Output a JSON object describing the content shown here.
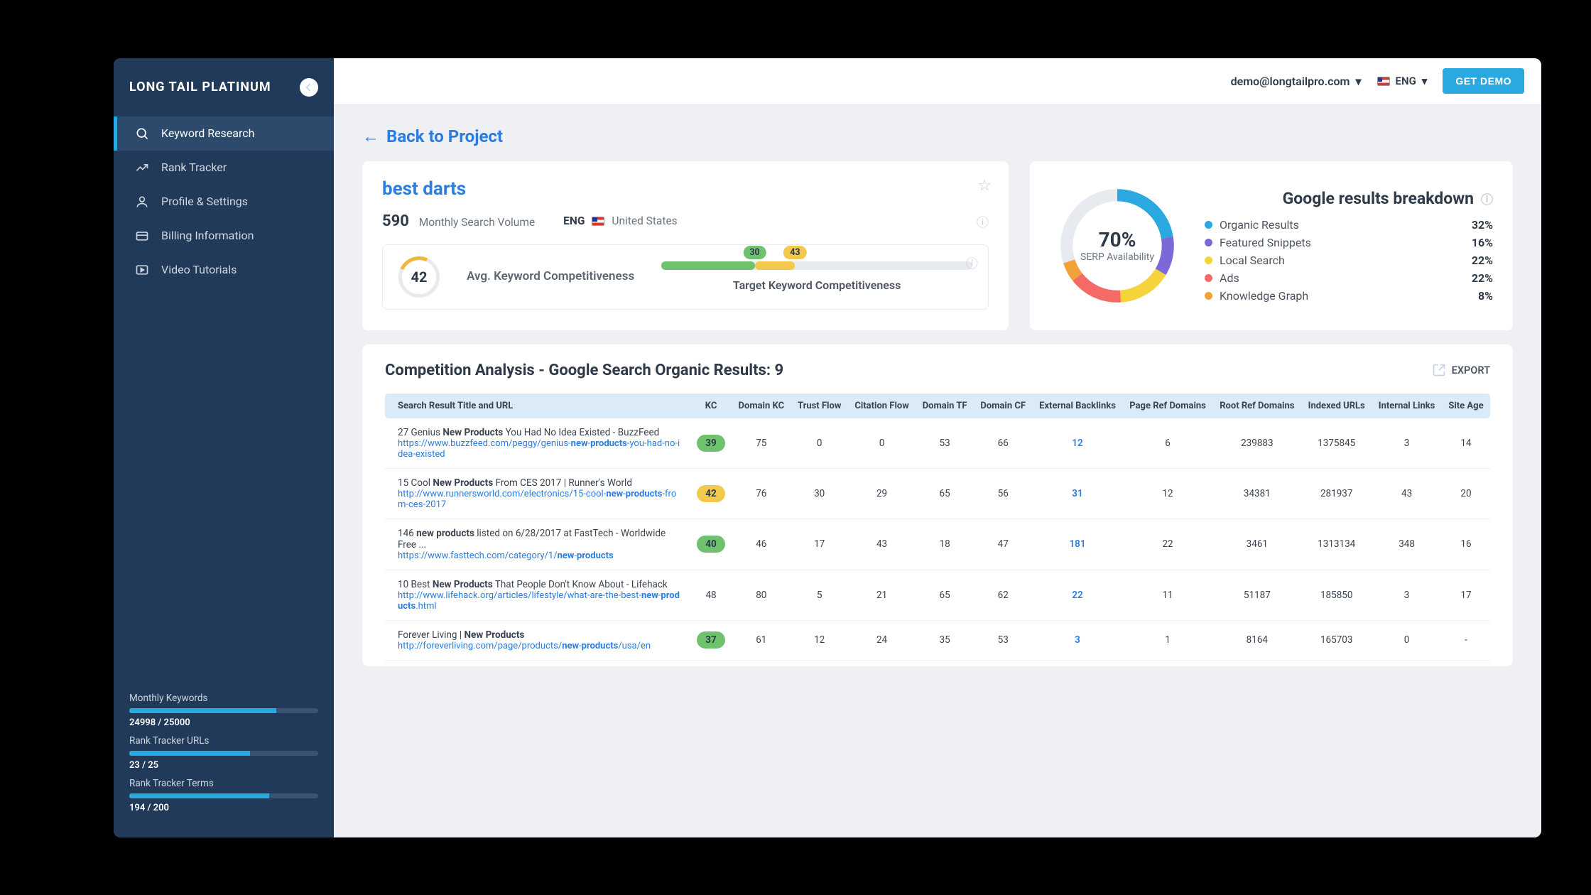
{
  "brand": "LONG TAIL PLATINUM",
  "nav": [
    {
      "label": "Keyword Research",
      "icon": "search-icon",
      "active": true
    },
    {
      "label": "Rank Tracker",
      "icon": "trend-icon",
      "active": false
    },
    {
      "label": "Profile & Settings",
      "icon": "user-icon",
      "active": false
    },
    {
      "label": "Billing Information",
      "icon": "card-icon",
      "active": false
    },
    {
      "label": "Video Tutorials",
      "icon": "video-icon",
      "active": false
    }
  ],
  "meters": [
    {
      "label": "Monthly Keywords",
      "value": "24998 / 25000",
      "pct": 78
    },
    {
      "label": "Rank Tracker URLs",
      "value": "23 / 25",
      "pct": 64
    },
    {
      "label": "Rank Tracker Terms",
      "value": "194 / 200",
      "pct": 74
    }
  ],
  "topbar": {
    "user": "demo@longtailpro.com",
    "lang": "ENG",
    "cta": "GET DEMO"
  },
  "back_label": "Back to Project",
  "keyword": {
    "title": "best darts",
    "volume": "590",
    "volume_label": "Monthly Search Volume",
    "lang": "ENG",
    "country": "United States"
  },
  "kc_block": {
    "value": "42",
    "label": "Avg. Keyword Competitiveness",
    "target_label": "Target Keyword Competitiveness",
    "pills": [
      {
        "v": "30",
        "color": "#6ec26e"
      },
      {
        "v": "43",
        "color": "#f2b63a"
      }
    ]
  },
  "serp": {
    "title": "Google results breakdown",
    "center_big": "70%",
    "center_small": "SERP Availability",
    "items": [
      {
        "label": "Organic Results",
        "pct": "32%",
        "color": "#2aa8e0"
      },
      {
        "label": "Featured Snippets",
        "pct": "16%",
        "color": "#7d68d8"
      },
      {
        "label": "Local Search",
        "pct": "22%",
        "color": "#f5d33b"
      },
      {
        "label": "Ads",
        "pct": "22%",
        "color": "#f36a66"
      },
      {
        "label": "Knowledge Graph",
        "pct": "8%",
        "color": "#f2a23a"
      }
    ]
  },
  "chart_data": {
    "type": "pie",
    "title": "Google results breakdown — SERP Availability 70%",
    "series": [
      {
        "name": "Organic Results",
        "value": 32,
        "color": "#2aa8e0"
      },
      {
        "name": "Featured Snippets",
        "value": 16,
        "color": "#7d68d8"
      },
      {
        "name": "Local Search",
        "value": 22,
        "color": "#f5d33b"
      },
      {
        "name": "Ads",
        "value": 22,
        "color": "#f36a66"
      },
      {
        "name": "Knowledge Graph",
        "value": 8,
        "color": "#f2a23a"
      }
    ]
  },
  "competition": {
    "title": "Competition Analysis - Google Search Organic Results: 9",
    "export": "EXPORT",
    "columns": [
      "Search Result Title and URL",
      "KC",
      "Domain KC",
      "Trust Flow",
      "Citation Flow",
      "Domain TF",
      "Domain CF",
      "External Backlinks",
      "Page Ref Domains",
      "Root Ref Domains",
      "Indexed URLs",
      "Internal Links",
      "Site Age"
    ],
    "rows": [
      {
        "title": "27 Genius <b>New Products</b> You Had No Idea Existed - BuzzFeed",
        "url": "https://www.buzzfeed.com/peggy/genius-<b>new</b>-<b>products</b>-you-had-no-idea-existed",
        "kc": "39",
        "kc_color": "#6ec26e",
        "cells": [
          "75",
          "0",
          "0",
          "53",
          "66",
          "12",
          "6",
          "239883",
          "1375845",
          "3",
          "14"
        ]
      },
      {
        "title": "15 Cool <b>New Products</b> From CES 2017 | Runner's World",
        "url": "http://www.runnersworld.com/electronics/15-cool-<b>new</b>-<b>products</b>-from-ces-2017",
        "kc": "42",
        "kc_color": "#f2c94c",
        "cells": [
          "76",
          "30",
          "29",
          "65",
          "56",
          "31",
          "12",
          "34381",
          "281937",
          "43",
          "20"
        ]
      },
      {
        "title": "146 <b>new products</b> listed on 6/28/2017 at FastTech - Worldwide Free ...",
        "url": "https://www.fasttech.com/category/1/<b>new</b>-<b>products</b>",
        "kc": "40",
        "kc_color": "#6ec26e",
        "cells": [
          "46",
          "17",
          "43",
          "18",
          "47",
          "181",
          "22",
          "3461",
          "1313134",
          "348",
          "16"
        ]
      },
      {
        "title": "10 Best <b>New Products</b> That People Don't Know About - Lifehack",
        "url": "http://www.lifehack.org/articles/lifestyle/what-are-the-best-<b>new</b>-<b>products</b>.html",
        "kc": "48",
        "kc_color": "",
        "cells": [
          "80",
          "5",
          "21",
          "65",
          "62",
          "22",
          "11",
          "51187",
          "185850",
          "3",
          "17"
        ]
      },
      {
        "title": "Forever Living | <b>New Products</b>",
        "url": "http://foreverliving.com/page/products/<b>new</b>-<b>products</b>/usa/en",
        "kc": "37",
        "kc_color": "#6ec26e",
        "cells": [
          "61",
          "12",
          "24",
          "35",
          "53",
          "3",
          "1",
          "8164",
          "165703",
          "0",
          "-"
        ]
      }
    ]
  }
}
